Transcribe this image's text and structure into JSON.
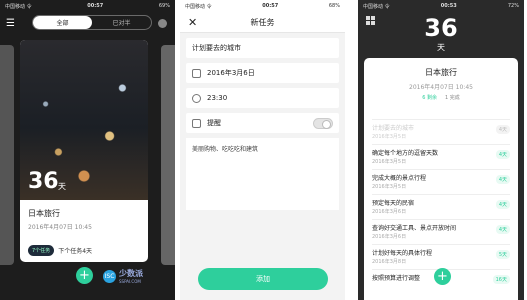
{
  "phone1": {
    "status": {
      "carrier": "中国移动 令",
      "time": "00:57",
      "battery": "69%"
    },
    "tabs": [
      "全部",
      "已对半"
    ],
    "card": {
      "days": "36",
      "days_unit": "天",
      "title": "日本旅行",
      "date": "2016年4月07日 10:45",
      "tag": "7个任务",
      "next": "下个任务4天"
    },
    "fab": "+",
    "watermark": {
      "logo": "ISC",
      "text": "少数派",
      "sub": "SSPAI.COM"
    }
  },
  "phone2": {
    "status": {
      "carrier": "中国移动 令",
      "time": "00:57",
      "battery": "68%"
    },
    "header": {
      "close": "✕",
      "title": "新任务"
    },
    "task_name": "计划要去的城市",
    "date": "2016年3月6日",
    "time": "23:30",
    "reminder_label": "提醒",
    "note": "美丽购物、吃吃吃和建筑",
    "add_button": "添加"
  },
  "phone3": {
    "status": {
      "carrier": "中国移动 令",
      "time": "00:53",
      "battery": "72%"
    },
    "days": "36",
    "days_unit": "天",
    "sheet": {
      "title": "日本旅行",
      "date": "2016年4月07日 10:45",
      "stats": [
        "6 剩余",
        "1 完成"
      ],
      "tasks": [
        {
          "name": "计划要去的城市",
          "date": "2016年3月5日",
          "badge": "4天",
          "faded": true
        },
        {
          "name": "确定每个地方的逗留天数",
          "date": "2016年3月5日",
          "badge": "4天",
          "faded": false
        },
        {
          "name": "完成大概的景点行程",
          "date": "2016年3月5日",
          "badge": "4天",
          "faded": false
        },
        {
          "name": "预定每天的民宿",
          "date": "2016年3月6日",
          "badge": "4天",
          "faded": false
        },
        {
          "name": "查询好交通工具、景点开放时间",
          "date": "2016年3月6日",
          "badge": "4天",
          "faded": false
        },
        {
          "name": "计划好每天的具体行程",
          "date": "2016年3月8日",
          "badge": "5天",
          "faded": false
        },
        {
          "name": "按照预算进行调整",
          "date": "",
          "badge": "16天",
          "faded": false
        }
      ]
    },
    "fab": "+"
  }
}
